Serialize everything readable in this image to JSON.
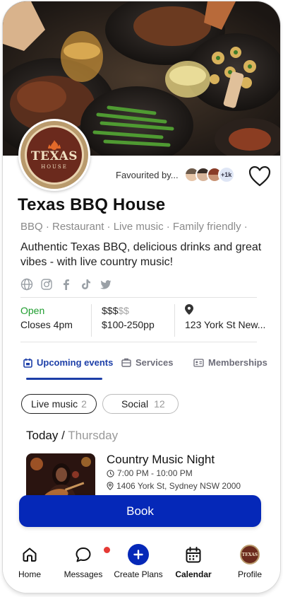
{
  "venue": {
    "name": "Texas BBQ House",
    "logo_text_top": "TEXAS",
    "logo_text_bottom": "HOUSE",
    "tags": "BBQ · Restaurant · Live music · Family friendly ·",
    "description": "Authentic Texas BBQ, delicious drinks and great vibes - with live country music!"
  },
  "favourited": {
    "label": "Favourited by...",
    "more_count": "+1k"
  },
  "socials": [
    "globe-icon",
    "instagram-icon",
    "facebook-icon",
    "tiktok-icon",
    "twitter-icon"
  ],
  "info": {
    "status": "Open",
    "closes": "Closes 4pm",
    "price_active": "$$$",
    "price_inactive": "$$",
    "price_range": "$100-250pp",
    "address": "123 York St New..."
  },
  "tabs": [
    {
      "label": "Upcoming events",
      "icon": "calendar-icon"
    },
    {
      "label": "Services",
      "icon": "briefcase-icon"
    },
    {
      "label": "Memberships",
      "icon": "id-card-icon"
    }
  ],
  "filters": [
    {
      "label": "Live music",
      "count": "2"
    },
    {
      "label": "Social",
      "count": "12"
    }
  ],
  "day": {
    "today": "Today",
    "separator": "/",
    "weekday": "Thursday"
  },
  "event": {
    "title": "Country Music Night",
    "time": "7:00 PM - 10:00 PM",
    "location": "1406 York St, Sydney NSW 2000"
  },
  "book_label": "Book",
  "nav": [
    {
      "label": "Home",
      "icon": "home-icon"
    },
    {
      "label": "Messages",
      "icon": "chat-icon"
    },
    {
      "label": "Create Plans",
      "icon": "plus-icon"
    },
    {
      "label": "Calendar",
      "icon": "calendar-icon"
    },
    {
      "label": "Profile",
      "icon": "avatar"
    }
  ],
  "colors": {
    "primary": "#0528b8",
    "tab_active": "#1d3fa8",
    "open_green": "#1f9d2f",
    "notification_red": "#e53935"
  }
}
